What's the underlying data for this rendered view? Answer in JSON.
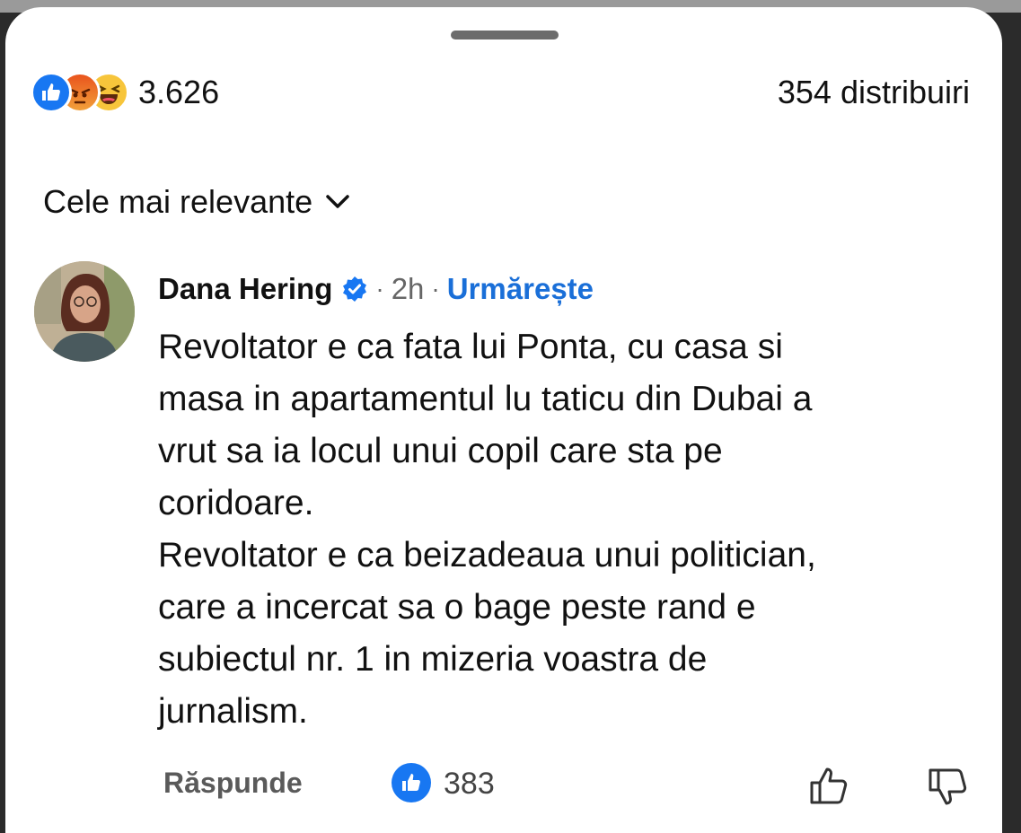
{
  "post": {
    "reaction_count": "3.626",
    "reaction_icons": [
      "like-icon",
      "angry-icon",
      "haha-icon"
    ],
    "shares": "354 distribuiri",
    "sort_label": "Cele mai relevante"
  },
  "comment": {
    "author": "Dana Hering",
    "verified": true,
    "separator": "·",
    "time": "2h",
    "follow_label": "Urmărește",
    "lines": [
      "Revoltator e ca fata lui Ponta, cu casa si",
      "masa in apartamentul lu taticu din Dubai a",
      "vrut sa ia locul unui copil care sta pe",
      "coridoare.",
      "Revoltator e ca beizadeaua unui politician,",
      "care a incercat sa o bage peste rand e",
      "subiectul nr. 1 in mizeria voastra de",
      "jurnalism."
    ],
    "reply_label": "Răspunde",
    "like_count": "383"
  },
  "colors": {
    "accent": "#1877f2",
    "follow": "#1a6fd8",
    "text": "#111111"
  }
}
